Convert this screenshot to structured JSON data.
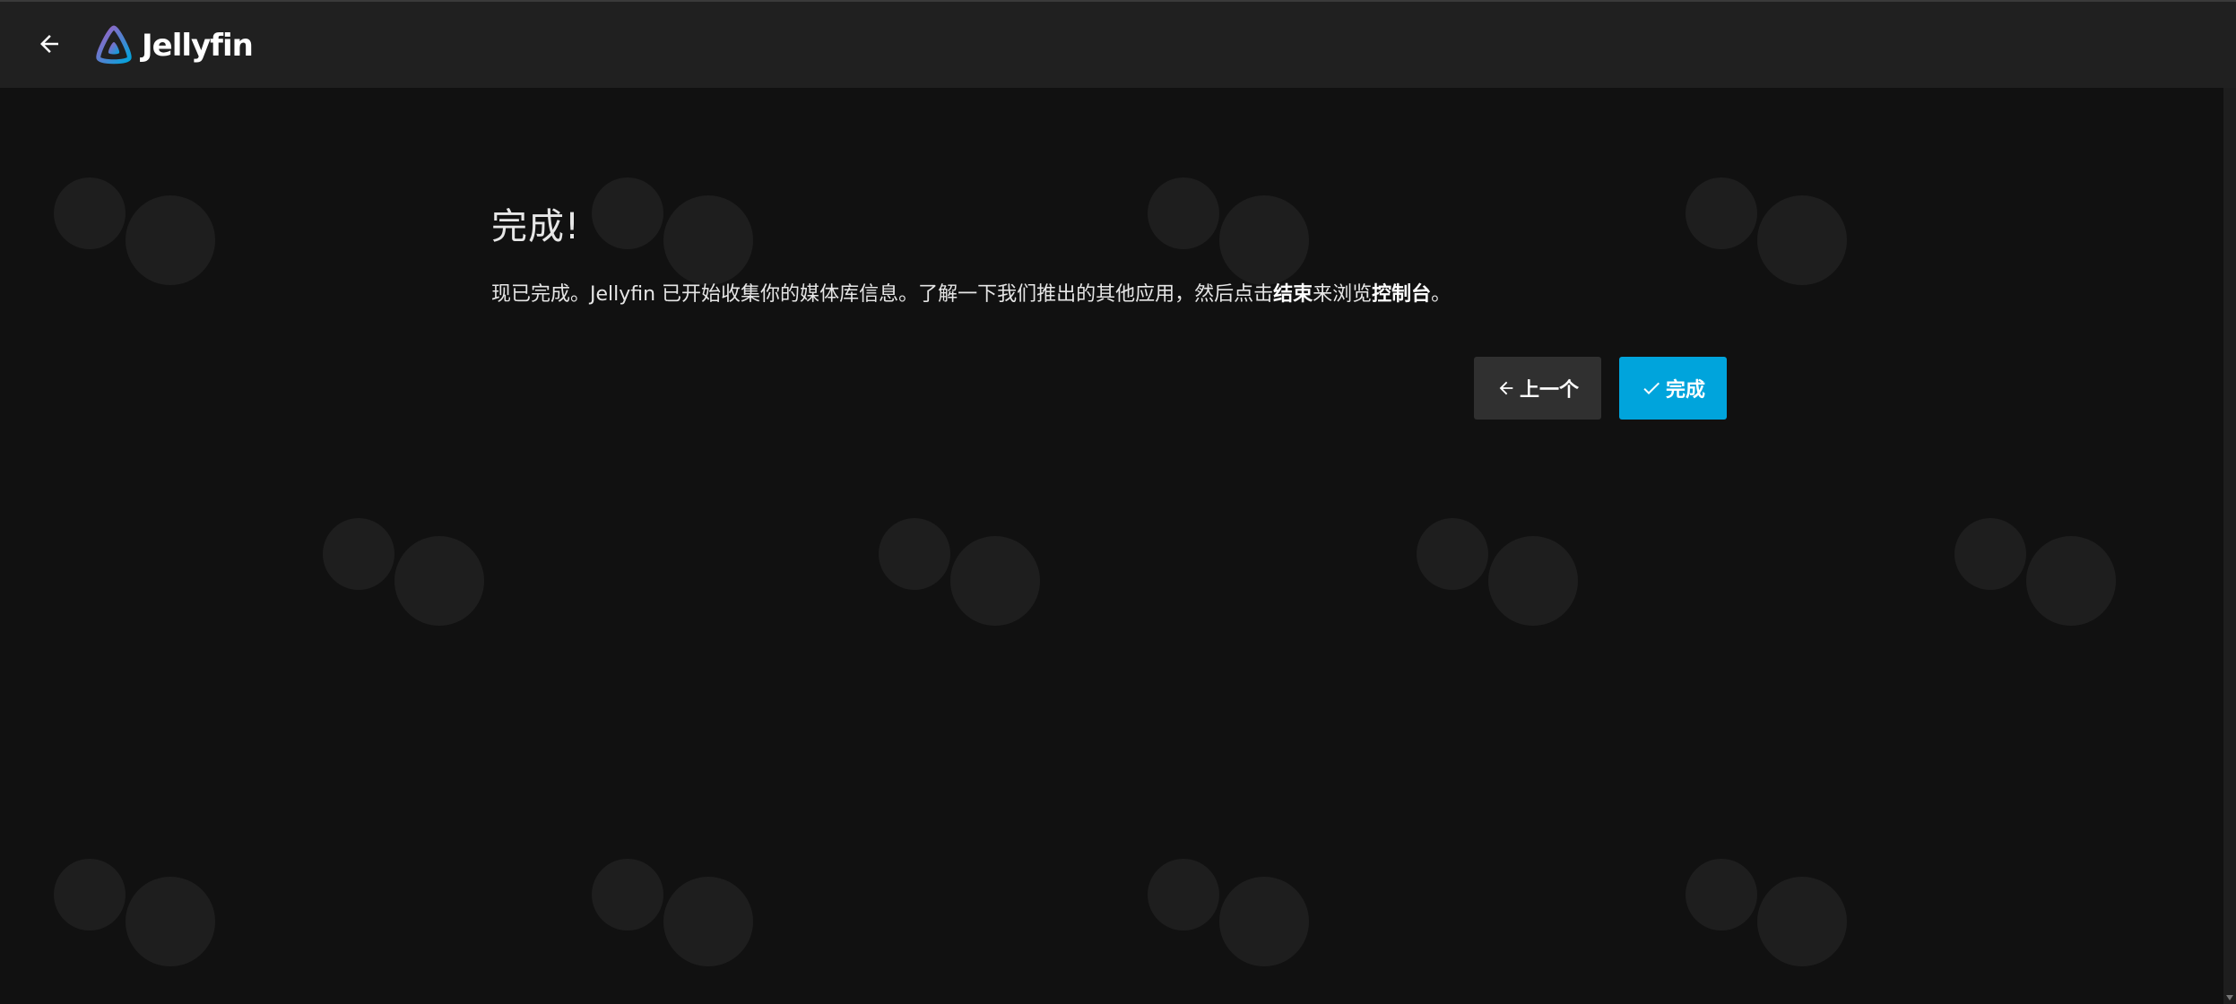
{
  "header": {
    "back_icon": "arrow-left-icon",
    "logo_icon": "jellyfin-triangle-logo",
    "brand": "Jellyfin"
  },
  "wizard": {
    "title": "完成!",
    "description_part1": "现已完成。Jellyfin 已开始收集你的媒体库信息。了解一下我们推出的其他应用，然后点击",
    "description_bold1": "结束",
    "description_part2": "来浏览",
    "description_bold2": "控制台",
    "description_part3": "。",
    "prev_button": "上一个",
    "prev_icon": "arrow-left-icon",
    "finish_button": "完成",
    "finish_icon": "check-icon"
  },
  "colors": {
    "accent": "#00a4dc",
    "header_bg": "#202020",
    "page_bg": "#111111",
    "secondary_button": "#303030"
  }
}
